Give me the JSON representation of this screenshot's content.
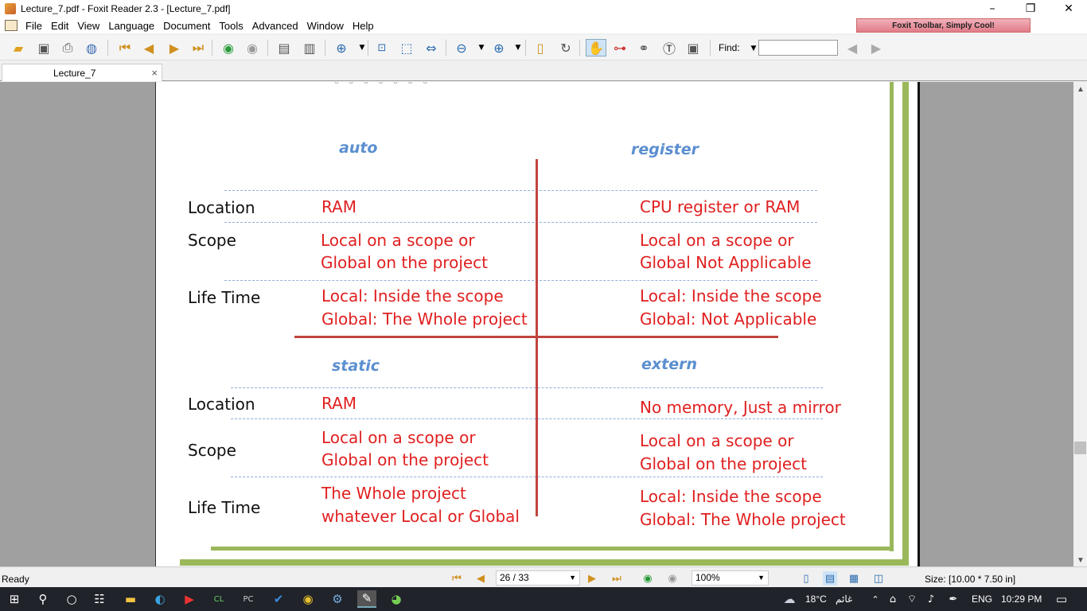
{
  "window": {
    "title": "Lecture_7.pdf - Foxit Reader 2.3 - [Lecture_7.pdf]"
  },
  "menu": [
    "File",
    "Edit",
    "View",
    "Language",
    "Document",
    "Tools",
    "Advanced",
    "Window",
    "Help"
  ],
  "promo": "Foxit Toolbar, Simply Cool!",
  "toolbar": {
    "find_label": "Find:"
  },
  "tab": {
    "label": "Lecture_7",
    "close": "×"
  },
  "slide": {
    "quadrants": {
      "auto": "auto",
      "register": "register",
      "static": "static",
      "extern": "extern"
    },
    "labels": {
      "location": "Location",
      "scope": "Scope",
      "lifetime": "Life Time"
    },
    "auto": {
      "location": "RAM",
      "scope_1": "Local on a scope or",
      "scope_2": "Global on the project",
      "life_1": "Local: Inside the scope",
      "life_2": "Global: The Whole project"
    },
    "register": {
      "location": "CPU register or RAM",
      "scope_1": "Local on a scope or",
      "scope_2": "Global Not Applicable",
      "life_1": "Local: Inside the scope",
      "life_2": "Global: Not Applicable"
    },
    "static": {
      "location": "RAM",
      "scope_1": "Local on a scope or",
      "scope_2": "Global on the project",
      "life_1": "The Whole project",
      "life_2": "whatever Local or Global"
    },
    "extern": {
      "location": "No memory, Just a mirror",
      "scope_1": "Local on a scope or",
      "scope_2": "Global on the project",
      "life_1": "Local: Inside the scope",
      "life_2": "Global: The Whole project"
    }
  },
  "status": {
    "ready": "Ready",
    "page": "26 / 33",
    "zoom": "100%",
    "size": "Size: [10.00 * 7.50 in]"
  },
  "taskbar": {
    "weather": "18°C",
    "weather_desc": "غائم",
    "lang": "ENG",
    "time": "10:29 PM"
  }
}
